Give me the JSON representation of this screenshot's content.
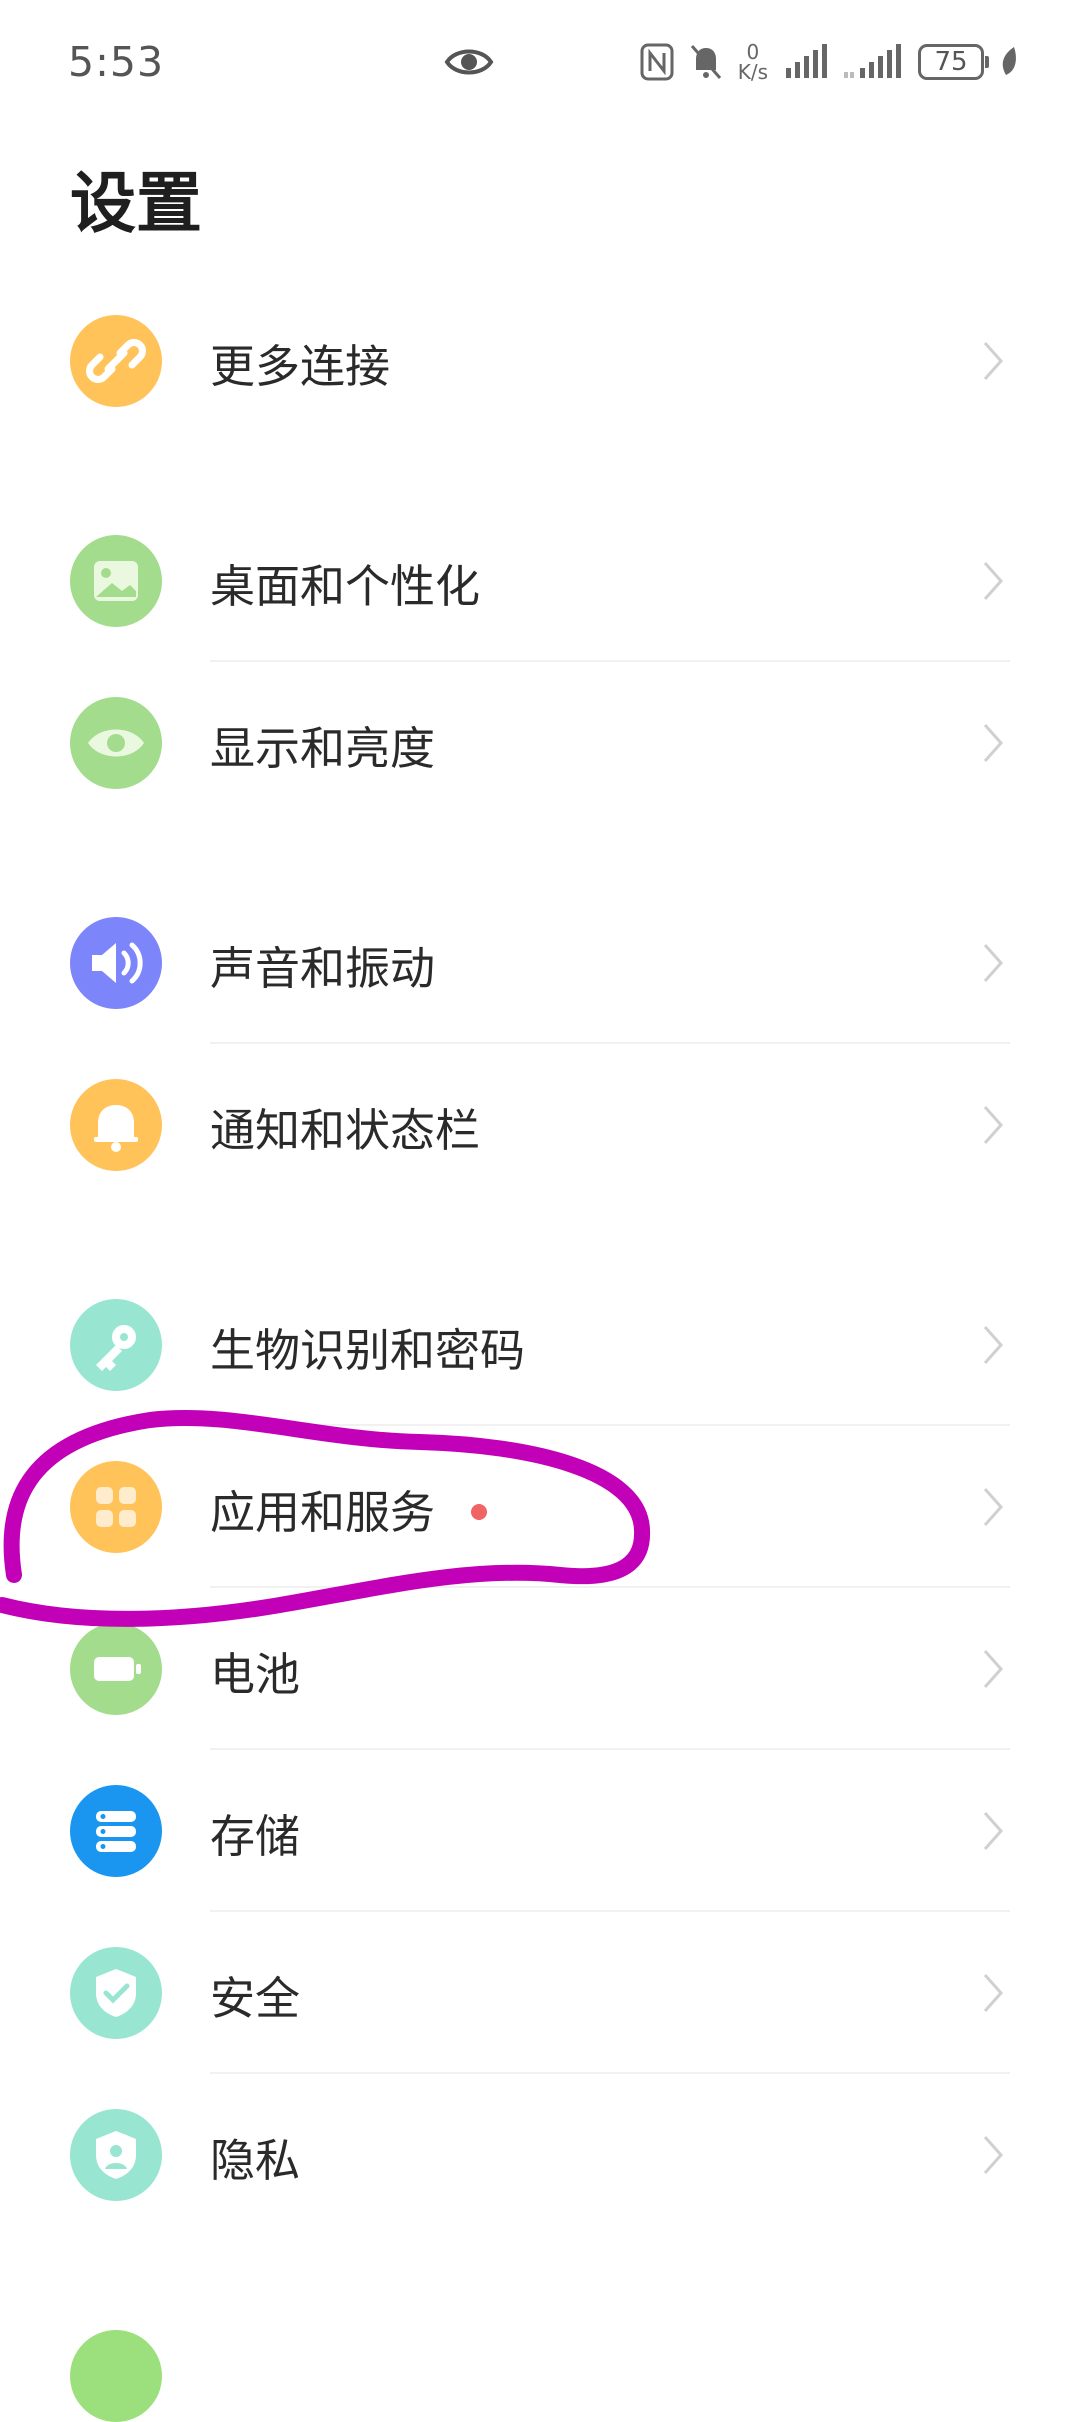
{
  "status_bar": {
    "time": "5:53",
    "net_speed_value": "0",
    "net_speed_unit": "K/s",
    "battery_level": "75",
    "icons": [
      "eye-icon",
      "nfc-icon",
      "mute-bell-icon",
      "signal-icon",
      "signal-icon",
      "leaf-icon"
    ]
  },
  "page": {
    "title": "设置"
  },
  "settings": [
    {
      "label": "更多连接",
      "icon": "link-icon",
      "color": "#ffc35a"
    },
    {
      "label": "桌面和个性化",
      "icon": "image-icon",
      "color": "#a3dc8c"
    },
    {
      "label": "显示和亮度",
      "icon": "eye-icon",
      "color": "#a3dc8c"
    },
    {
      "label": "声音和振动",
      "icon": "speaker-icon",
      "color": "#7d85fb"
    },
    {
      "label": "通知和状态栏",
      "icon": "bell-icon",
      "color": "#ffc35a"
    },
    {
      "label": "生物识别和密码",
      "icon": "key-icon",
      "color": "#98e6d2"
    },
    {
      "label": "应用和服务",
      "icon": "apps-icon",
      "color": "#ffc35a",
      "has_badge": true
    },
    {
      "label": "电池",
      "icon": "battery-icon",
      "color": "#a3dc8c"
    },
    {
      "label": "存储",
      "icon": "storage-icon",
      "color": "#1a96f0"
    },
    {
      "label": "安全",
      "icon": "shield-check-icon",
      "color": "#98e6d2"
    },
    {
      "label": "隐私",
      "icon": "shield-person-icon",
      "color": "#98e6d2"
    }
  ],
  "colors": {
    "annotation": "#c200b8",
    "badge": "#f06464"
  }
}
